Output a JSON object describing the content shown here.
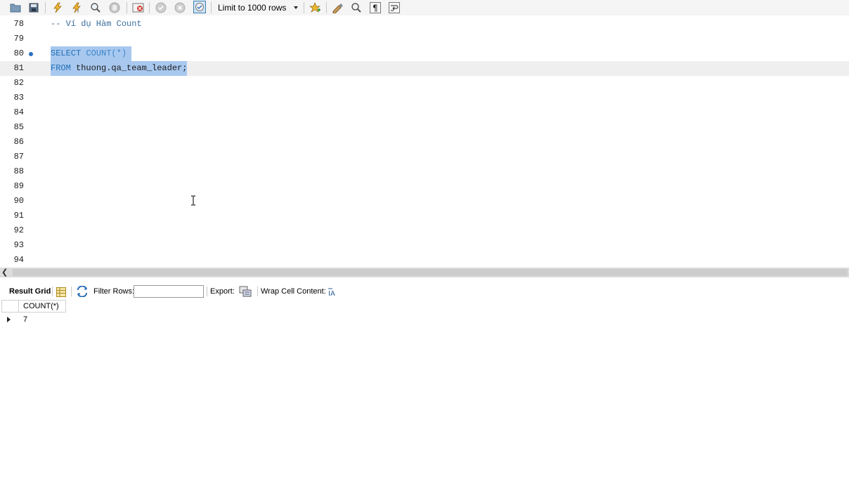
{
  "toolbar": {
    "limit_select": "Limit to 1000 rows",
    "icons": [
      "open-folder-icon",
      "save-icon",
      "execute-icon",
      "execute-current-icon",
      "explain-icon",
      "stop-icon",
      "toggle-error-icon",
      "commit-icon",
      "rollback-icon",
      "autocommit-icon",
      "bookmark-icon",
      "beautify-icon",
      "find-icon",
      "invisible-chars-icon",
      "wrap-icon"
    ]
  },
  "editor": {
    "lines": [
      {
        "num": "78",
        "text": "-- Ví dụ Hàm Count"
      },
      {
        "num": "79",
        "text": ""
      },
      {
        "num": "80",
        "kw": "SELECT",
        "fn": "COUNT(*)"
      },
      {
        "num": "81",
        "kw": "FROM",
        "rest": "thuong.qa_team_leader;"
      },
      {
        "num": "82",
        "text": ""
      },
      {
        "num": "83",
        "text": ""
      },
      {
        "num": "84",
        "text": ""
      },
      {
        "num": "85",
        "text": ""
      },
      {
        "num": "86",
        "text": ""
      },
      {
        "num": "87",
        "text": ""
      },
      {
        "num": "88",
        "text": ""
      },
      {
        "num": "89",
        "text": ""
      },
      {
        "num": "90",
        "text": ""
      },
      {
        "num": "91",
        "text": ""
      },
      {
        "num": "92",
        "text": ""
      },
      {
        "num": "93",
        "text": ""
      },
      {
        "num": "94",
        "text": ""
      }
    ],
    "line78": "-- Ví dụ Hàm Count",
    "line80_kw": "SELECT",
    "line80_fn": "COUNT(*)",
    "line81_kw": "FROM",
    "line81_rest": "thuong.qa_team_leader;"
  },
  "result_toolbar": {
    "result_grid": "Result Grid",
    "filter_rows": "Filter Rows:",
    "filter_value": "",
    "export": "Export:",
    "wrap_cell": "Wrap Cell Content:"
  },
  "grid": {
    "columns": [
      "COUNT(*)"
    ],
    "rows": [
      [
        "7"
      ]
    ]
  },
  "colors": {
    "selection": "#a8c8ef",
    "keyword": "#1f6fb5",
    "comment": "#3d6e9e",
    "marker": "#2a6fc4"
  }
}
